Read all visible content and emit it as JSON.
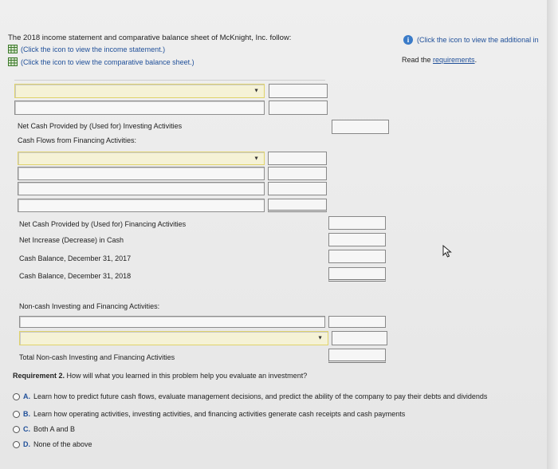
{
  "header": {
    "intro": "The 2018 income statement and comparative balance sheet of McKnight, Inc. follow:",
    "income_link": "(Click the icon to view the income statement.)",
    "balance_link": "(Click the icon to view the comparative balance sheet.)",
    "info_link": "(Click the icon to view the additional in",
    "read_prefix": "Read the ",
    "requirements_link": "requirements",
    "read_suffix": "."
  },
  "rows": {
    "net_investing": "Net Cash Provided by (Used for) Investing Activities",
    "financing_heading": "Cash Flows from Financing Activities:",
    "net_financing": "Net Cash Provided by (Used for) Financing Activities",
    "net_increase": "Net Increase (Decrease) in Cash",
    "balance_2017": "Cash Balance, December 31, 2017",
    "balance_2018": "Cash Balance, December 31, 2018",
    "noncash_heading": "Non-cash Investing and Financing Activities:",
    "total_noncash": "Total Non-cash Investing and Financing Activities"
  },
  "requirement": {
    "label": "Requirement 2.",
    "question": " How will what you learned in this problem help you evaluate an investment?",
    "options": [
      {
        "letter": "A.",
        "text": "Learn how to predict future cash flows, evaluate management decisions, and predict the ability of the company to pay their debts and dividends"
      },
      {
        "letter": "B.",
        "text": "Learn how operating activities, investing activities, and financing activities generate cash receipts and cash payments"
      },
      {
        "letter": "C.",
        "text": "Both A and B"
      },
      {
        "letter": "D.",
        "text": "None of the above"
      }
    ]
  },
  "icons": {
    "table": "spreadsheet-icon",
    "info": "info-icon",
    "dropdown": "triangle-down",
    "cursor": "mouse-pointer"
  },
  "colors": {
    "link": "#1f4f99",
    "info": "#3a7bc8",
    "highlight_border": "#e0d36a"
  }
}
